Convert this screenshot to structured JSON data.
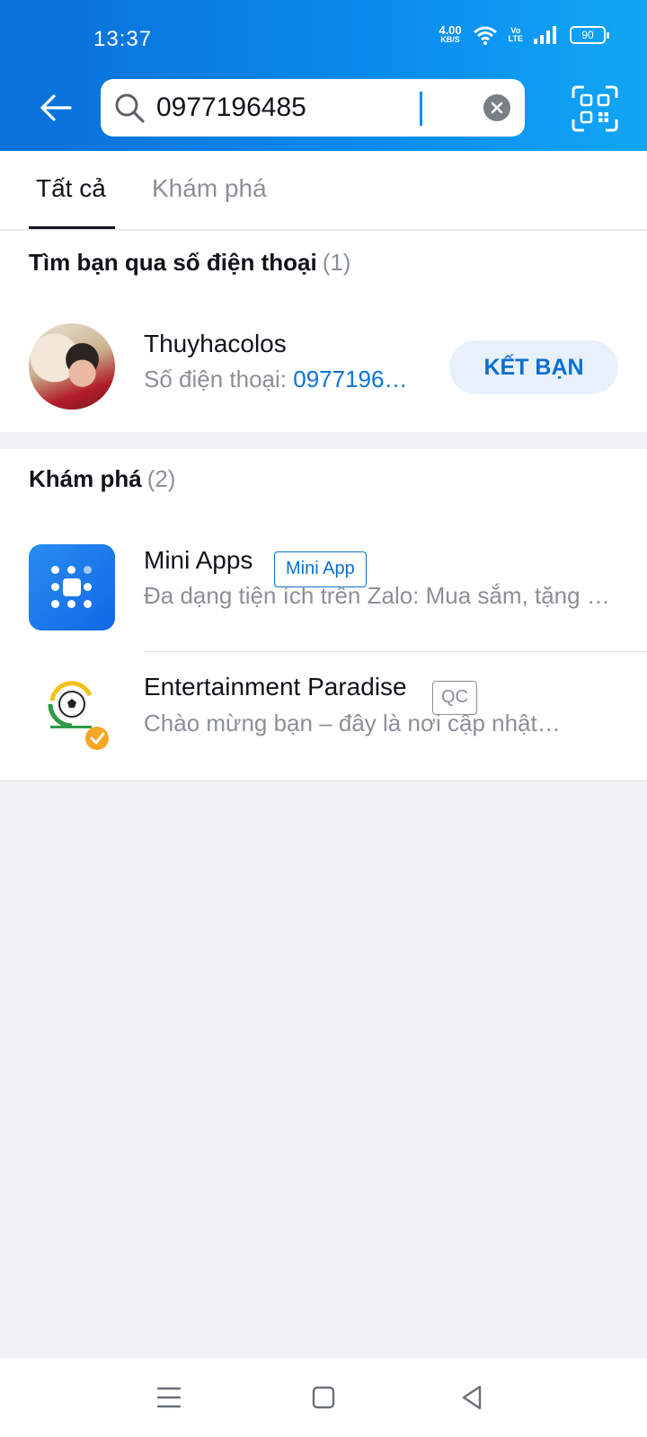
{
  "status_bar": {
    "time": "13:37",
    "net_speed": "4.00",
    "net_unit": "KB/S",
    "volte_top": "Vo",
    "volte_bottom": "LTE",
    "battery": "90"
  },
  "search": {
    "value": "0977196485",
    "icons": [
      "arrow-left-icon",
      "search-icon",
      "clear-icon",
      "qr-scan-icon"
    ]
  },
  "tabs": [
    {
      "label": "Tất cả",
      "active": true
    },
    {
      "label": "Khám phá",
      "active": false
    }
  ],
  "phone_section": {
    "title": "Tìm bạn qua số điện thoại",
    "count": "(1)",
    "result": {
      "name": "Thuyhacolos",
      "phone_label": "Số điện thoại: ",
      "phone_value": "0977196…",
      "action": "KẾT BẠN"
    }
  },
  "explore_section": {
    "title": "Khám phá",
    "count": "(2)",
    "items": [
      {
        "name": "Mini Apps",
        "tag": "Mini App",
        "description": "Đa dạng tiện ích trên Zalo: Mua sắm, tặng qu…"
      },
      {
        "name": "Entertainment Paradise",
        "tag": "QC",
        "description": "Chào mừng bạn – đây là nơi cập nhật…"
      }
    ]
  },
  "colors": {
    "header": "#0a8cef",
    "accent": "#0a6fd0",
    "muted_text": "#8b9096",
    "background": "#f1f2f4"
  }
}
